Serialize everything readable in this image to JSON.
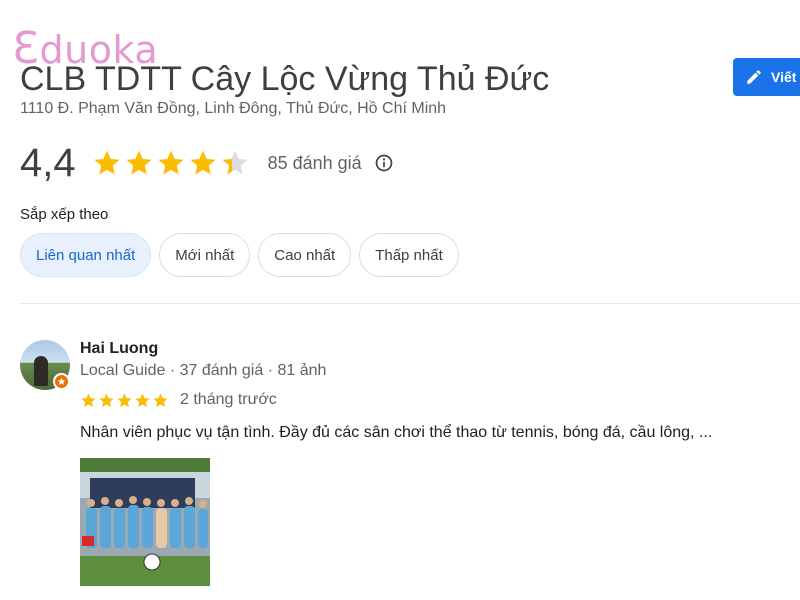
{
  "watermark": {
    "logo_text": "Eduoka"
  },
  "place": {
    "title": "CLB TDTT Cây Lộc Vừng Thủ Đức",
    "address": "1110 Đ. Phạm Văn Đồng, Linh Đông, Thủ Đức, Hồ Chí Minh"
  },
  "actions": {
    "write_review_label": "Viết"
  },
  "rating": {
    "value_text": "4,4",
    "value": 4.4,
    "max": 5,
    "count_text": "85 đánh giá"
  },
  "sort": {
    "label": "Sắp xếp theo",
    "options": [
      {
        "label": "Liên quan nhất",
        "active": true
      },
      {
        "label": "Mới nhất",
        "active": false
      },
      {
        "label": "Cao nhất",
        "active": false
      },
      {
        "label": "Thấp nhất",
        "active": false
      }
    ]
  },
  "review": {
    "author": "Hai Luong",
    "meta": "Local Guide · 37 đánh giá · 81 ảnh",
    "stars": 5,
    "time": "2 tháng trước",
    "text": "Nhân viên phục vụ tận tình. Đầy đủ các sân chơi thể thao từ tennis, bóng đá, cầu lông, ..."
  },
  "colors": {
    "star": "#fbbc04",
    "star_empty": "#dadce0",
    "accent": "#1a73e8",
    "logo": "#e39ad0",
    "chip_active_bg": "#e8f0fe",
    "chip_active_text": "#1967d2",
    "local_guide_badge": "#e8710a"
  },
  "icons": {
    "write": "pencil-icon",
    "info": "info-icon",
    "star": "star-icon",
    "badge": "local-guide-badge-icon"
  }
}
